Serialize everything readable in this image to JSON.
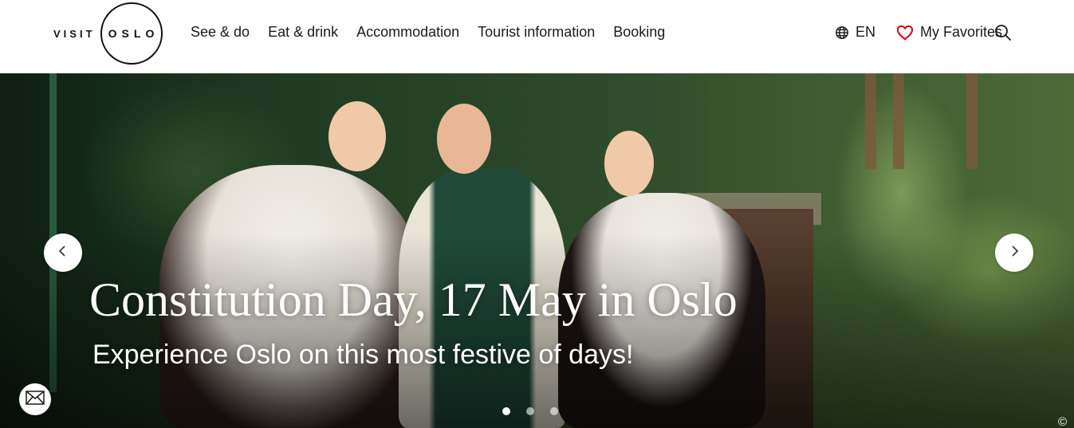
{
  "logo": {
    "visit": "VISIT",
    "oslo": "OSLO"
  },
  "nav": {
    "items": [
      {
        "label": "See & do"
      },
      {
        "label": "Eat & drink"
      },
      {
        "label": "Accommodation"
      },
      {
        "label": "Tourist information"
      },
      {
        "label": "Booking"
      }
    ]
  },
  "utils": {
    "language": "EN",
    "favorites": "My Favorites",
    "favorites_color": "#d0021b"
  },
  "hero": {
    "title": "Constitution Day, 17 May in Oslo",
    "subtitle": "Experience Oslo on this most festive of days!",
    "slide_count": 3,
    "active_slide": 1,
    "copyright": "©"
  }
}
